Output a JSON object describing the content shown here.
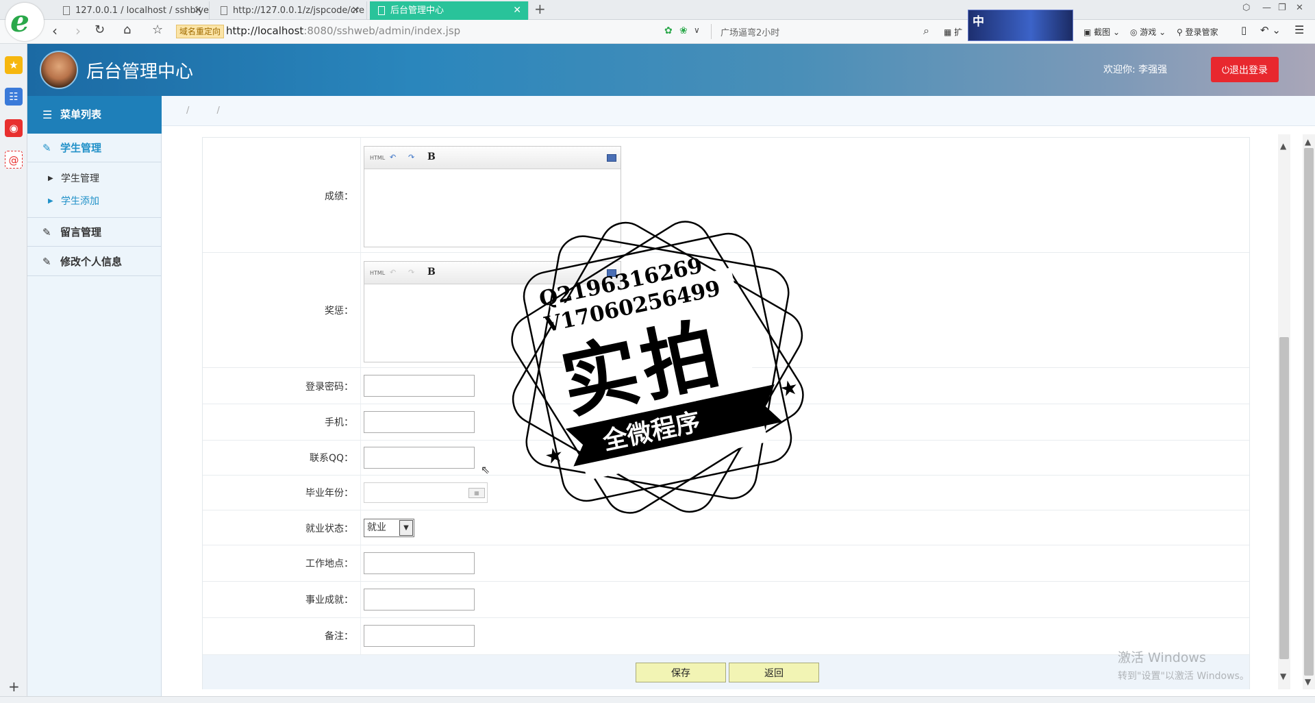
{
  "browser": {
    "tabs": [
      {
        "title": "127.0.0.1 / localhost / sshbiye",
        "active": false
      },
      {
        "title": "http://127.0.0.1/z/jspcode/cre",
        "active": false
      },
      {
        "title": "后台管理中心",
        "active": true
      }
    ],
    "redirect_badge": "域名重定向",
    "url_host": "http://localhost",
    "url_path": ":8080/sshweb/admin/index.jsp",
    "hint": "广场逼弯2小时",
    "ad_text": "中",
    "toolbar": {
      "ext": "扩",
      "screenshot": "截图",
      "games": "游戏",
      "login_manager": "登录管家"
    }
  },
  "header": {
    "title": "后台管理中心",
    "welcome": "欢迎你: 李强强",
    "logout": "⏻退出登录"
  },
  "sidebar": {
    "title": "菜单列表",
    "sections": [
      {
        "label": "学生管理",
        "active": true,
        "items": [
          {
            "label": "学生管理",
            "active": false
          },
          {
            "label": "学生添加",
            "active": true
          }
        ]
      },
      {
        "label": "留言管理",
        "active": false,
        "items": []
      },
      {
        "label": "修改个人信息",
        "active": false,
        "items": []
      }
    ]
  },
  "breadcrumb": "/ /",
  "form": {
    "fields": {
      "score": "成绩：",
      "awards": "奖惩：",
      "password": "登录密码：",
      "phone": "手机：",
      "qq": "联系QQ：",
      "grad_year": "毕业年份：",
      "employment_status": "就业状态：",
      "work_location": "工作地点：",
      "achievement": "事业成就：",
      "remark": "备注："
    },
    "employment_selected": "就业",
    "editor_toolbar": {
      "html": "HTML",
      "bold": "B"
    },
    "save": "保存",
    "back": "返回"
  },
  "stamp": {
    "line1": "Q2196316269",
    "line2": "V17060256499",
    "big": "实拍",
    "banner": "全微程序"
  },
  "windows_watermark": {
    "line1": "激活 Windows",
    "line2": "转到\"设置\"以激活 Windows。"
  },
  "colors": {
    "accent": "#2191c8",
    "header_start": "#1b6aa4",
    "logout": "#e8282e",
    "button_bg": "#f2f4b4"
  }
}
